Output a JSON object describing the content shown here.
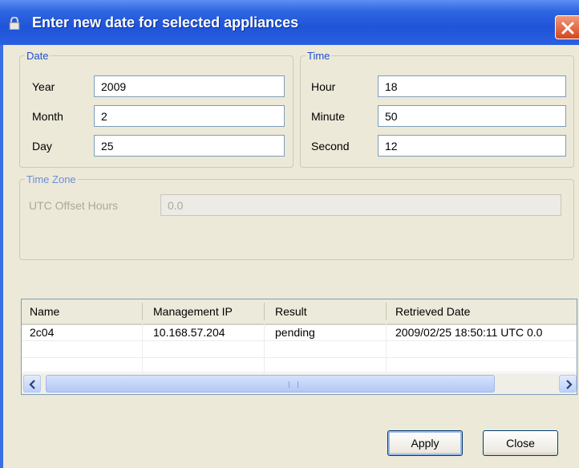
{
  "window": {
    "title": "Enter new date for selected appliances",
    "icons": {
      "title": "lock-icon",
      "close": "close-icon"
    },
    "colors": {
      "titlebar": "#2f66e0",
      "client": "#ece9d8",
      "legend": "#1e4fd0"
    }
  },
  "date_group": {
    "legend": "Date",
    "year_label": "Year",
    "year_value": "2009",
    "month_label": "Month",
    "month_value": "2",
    "day_label": "Day",
    "day_value": "25"
  },
  "time_group": {
    "legend": "Time",
    "hour_label": "Hour",
    "hour_value": "18",
    "minute_label": "Minute",
    "minute_value": "50",
    "second_label": "Second",
    "second_value": "12"
  },
  "timezone_group": {
    "legend": "Time Zone",
    "utc_label": "UTC Offset Hours",
    "utc_value": "0.0"
  },
  "table": {
    "columns": [
      "Name",
      "Management IP",
      "Result",
      "Retrieved Date"
    ],
    "rows": [
      [
        "2c04",
        "10.168.57.204",
        "pending",
        "2009/02/25 18:50:11  UTC 0.0"
      ]
    ]
  },
  "buttons": {
    "apply": "Apply",
    "close": "Close"
  }
}
